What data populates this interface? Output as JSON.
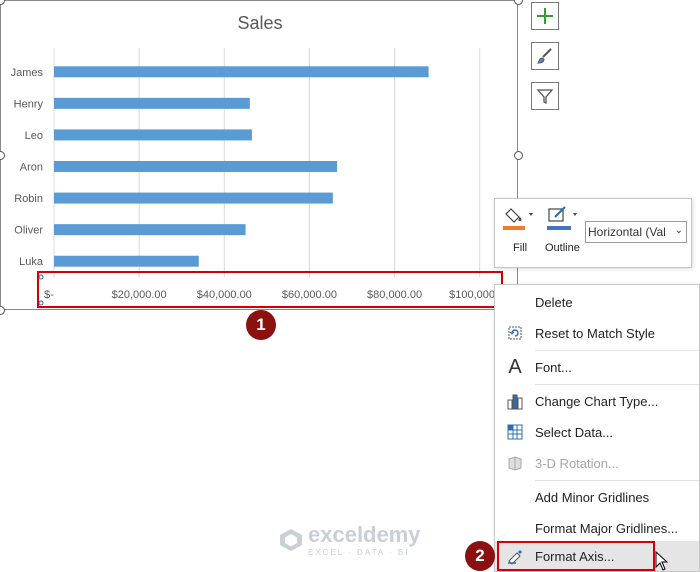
{
  "chart": {
    "title": "Sales"
  },
  "chart_data": {
    "type": "bar",
    "orientation": "horizontal",
    "title": "Sales",
    "categories": [
      "James",
      "Henry",
      "Leo",
      "Aron",
      "Robin",
      "Oliver",
      "Luka"
    ],
    "values": [
      88000,
      46000,
      46500,
      66500,
      65500,
      45000,
      34000
    ],
    "xlim": [
      0,
      105000
    ],
    "tick_values": [
      0,
      20000,
      40000,
      60000,
      80000,
      100000
    ],
    "tick_labels": [
      "$-",
      "$20,000.00",
      "$40,000.00",
      "$60,000.00",
      "$80,000.00",
      "$100,000.00"
    ],
    "grid": true,
    "bar_color": "#5b9bd5"
  },
  "side_buttons": [
    "plus-icon",
    "brush-icon",
    "filter-icon"
  ],
  "format_bar": {
    "fill_label": "Fill",
    "outline_label": "Outline",
    "selection": "Horizontal (Val"
  },
  "context_menu": {
    "items": [
      {
        "label": "Delete",
        "icon": "none"
      },
      {
        "label": "Reset to Match Style",
        "icon": "reset-style-icon"
      },
      {
        "label": "Font...",
        "icon": "font-icon"
      },
      {
        "label": "Change Chart Type...",
        "icon": "chart-type-icon"
      },
      {
        "label": "Select Data...",
        "icon": "select-data-icon"
      },
      {
        "label": "3-D Rotation...",
        "icon": "rotation-icon"
      },
      {
        "label": "Add Minor Gridlines",
        "icon": "none"
      },
      {
        "label": "Format Major Gridlines...",
        "icon": "none"
      },
      {
        "label": "Format Axis...",
        "icon": "format-axis-icon"
      }
    ]
  },
  "annotations": {
    "step1": "1",
    "step2": "2"
  },
  "colors": {
    "highlight_red": "#d60000",
    "badge": "#8b1010",
    "fill_swatch": "#ed7d31",
    "outline_swatch": "#4472c4"
  },
  "watermark": {
    "brand": "exceldemy",
    "tagline": "EXCEL · DATA · BI"
  }
}
